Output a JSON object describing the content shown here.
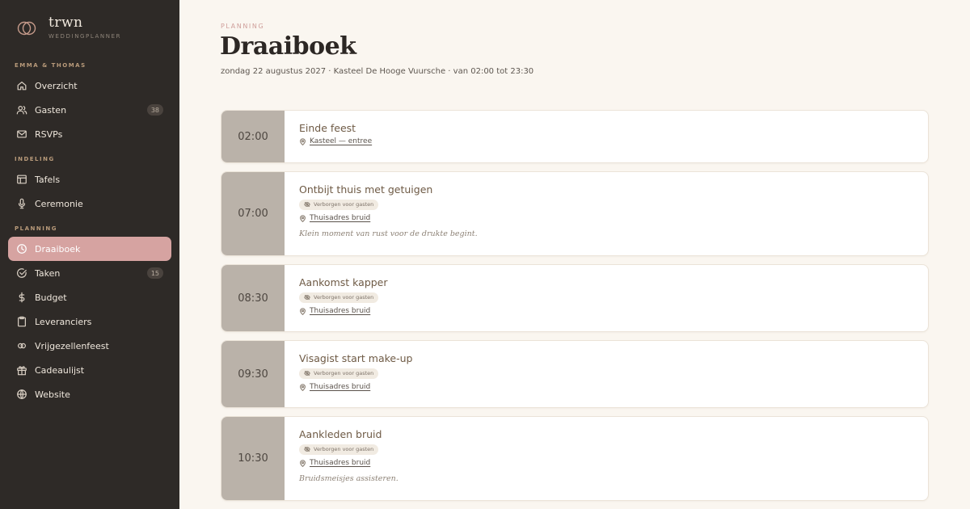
{
  "brand": {
    "name": "trwn",
    "subtitle": "WEDDINGPLANNER"
  },
  "sidebar": {
    "sections": [
      {
        "label": "EMMA & THOMAS"
      },
      {
        "label": "INDELING"
      },
      {
        "label": "PLANNING"
      }
    ],
    "items": [
      {
        "label": "Overzicht",
        "icon": "home-icon"
      },
      {
        "label": "Gasten",
        "icon": "users-icon",
        "badge": "38"
      },
      {
        "label": "RSVPs",
        "icon": "mail-icon"
      },
      {
        "label": "Tafels",
        "icon": "layout-icon"
      },
      {
        "label": "Ceremonie",
        "icon": "mic-icon"
      },
      {
        "label": "Draaiboek",
        "icon": "clock-icon",
        "active": true
      },
      {
        "label": "Taken",
        "icon": "check-circle-icon",
        "badge": "15"
      },
      {
        "label": "Budget",
        "icon": "dollar-icon"
      },
      {
        "label": "Leveranciers",
        "icon": "clipboard-icon"
      },
      {
        "label": "Vrijgezellenfeest",
        "icon": "rings-icon"
      },
      {
        "label": "Cadeaulijst",
        "icon": "gift-icon"
      },
      {
        "label": "Website",
        "icon": "globe-icon"
      }
    ]
  },
  "main": {
    "eyebrow": "PLANNING",
    "title": "Draaiboek",
    "subtitle": "zondag 22 augustus 2027 · Kasteel De Hooge Vuursche · van 02:00 tot 23:30",
    "hidden_label": "Verborgen voor gasten",
    "events": [
      {
        "time": "02:00",
        "title": "Einde feest",
        "location": "Kasteel — entree"
      },
      {
        "time": "07:00",
        "title": "Ontbijt thuis met getuigen",
        "location": "Thuisadres bruid",
        "note": "Klein moment van rust voor de drukte begint."
      },
      {
        "time": "08:30",
        "title": "Aankomst kapper",
        "location": "Thuisadres bruid"
      },
      {
        "time": "09:30",
        "title": "Visagist start make-up",
        "location": "Thuisadres bruid"
      },
      {
        "time": "10:30",
        "title": "Aankleden bruid",
        "location": "Thuisadres bruid",
        "note": "Bruidsmeisjes assisteren."
      }
    ]
  },
  "colors": {
    "sidebar_bg": "#2e2a27",
    "accent": "#d6a3a1",
    "time_block": "#bab2a9",
    "page_bg": "#faf6f0"
  }
}
